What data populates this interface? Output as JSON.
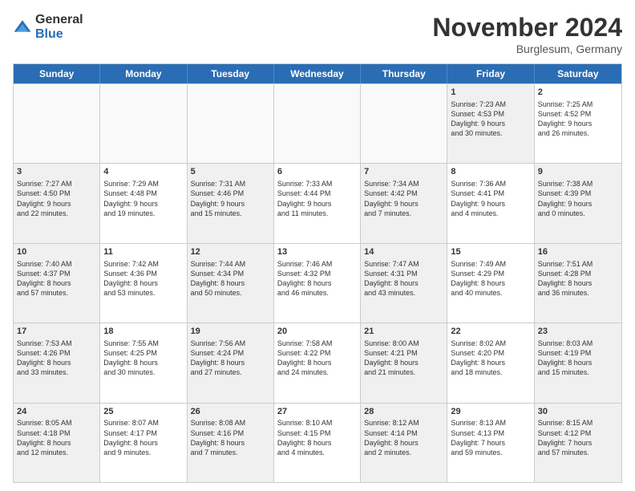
{
  "logo": {
    "general": "General",
    "blue": "Blue"
  },
  "title": "November 2024",
  "location": "Burglesum, Germany",
  "header_days": [
    "Sunday",
    "Monday",
    "Tuesday",
    "Wednesday",
    "Thursday",
    "Friday",
    "Saturday"
  ],
  "weeks": [
    [
      {
        "day": "",
        "info": "",
        "shaded": false,
        "empty": true
      },
      {
        "day": "",
        "info": "",
        "shaded": false,
        "empty": true
      },
      {
        "day": "",
        "info": "",
        "shaded": false,
        "empty": true
      },
      {
        "day": "",
        "info": "",
        "shaded": false,
        "empty": true
      },
      {
        "day": "",
        "info": "",
        "shaded": false,
        "empty": true
      },
      {
        "day": "1",
        "info": "Sunrise: 7:23 AM\nSunset: 4:53 PM\nDaylight: 9 hours\nand 30 minutes.",
        "shaded": true,
        "empty": false
      },
      {
        "day": "2",
        "info": "Sunrise: 7:25 AM\nSunset: 4:52 PM\nDaylight: 9 hours\nand 26 minutes.",
        "shaded": false,
        "empty": false
      }
    ],
    [
      {
        "day": "3",
        "info": "Sunrise: 7:27 AM\nSunset: 4:50 PM\nDaylight: 9 hours\nand 22 minutes.",
        "shaded": true,
        "empty": false
      },
      {
        "day": "4",
        "info": "Sunrise: 7:29 AM\nSunset: 4:48 PM\nDaylight: 9 hours\nand 19 minutes.",
        "shaded": false,
        "empty": false
      },
      {
        "day": "5",
        "info": "Sunrise: 7:31 AM\nSunset: 4:46 PM\nDaylight: 9 hours\nand 15 minutes.",
        "shaded": true,
        "empty": false
      },
      {
        "day": "6",
        "info": "Sunrise: 7:33 AM\nSunset: 4:44 PM\nDaylight: 9 hours\nand 11 minutes.",
        "shaded": false,
        "empty": false
      },
      {
        "day": "7",
        "info": "Sunrise: 7:34 AM\nSunset: 4:42 PM\nDaylight: 9 hours\nand 7 minutes.",
        "shaded": true,
        "empty": false
      },
      {
        "day": "8",
        "info": "Sunrise: 7:36 AM\nSunset: 4:41 PM\nDaylight: 9 hours\nand 4 minutes.",
        "shaded": false,
        "empty": false
      },
      {
        "day": "9",
        "info": "Sunrise: 7:38 AM\nSunset: 4:39 PM\nDaylight: 9 hours\nand 0 minutes.",
        "shaded": true,
        "empty": false
      }
    ],
    [
      {
        "day": "10",
        "info": "Sunrise: 7:40 AM\nSunset: 4:37 PM\nDaylight: 8 hours\nand 57 minutes.",
        "shaded": true,
        "empty": false
      },
      {
        "day": "11",
        "info": "Sunrise: 7:42 AM\nSunset: 4:36 PM\nDaylight: 8 hours\nand 53 minutes.",
        "shaded": false,
        "empty": false
      },
      {
        "day": "12",
        "info": "Sunrise: 7:44 AM\nSunset: 4:34 PM\nDaylight: 8 hours\nand 50 minutes.",
        "shaded": true,
        "empty": false
      },
      {
        "day": "13",
        "info": "Sunrise: 7:46 AM\nSunset: 4:32 PM\nDaylight: 8 hours\nand 46 minutes.",
        "shaded": false,
        "empty": false
      },
      {
        "day": "14",
        "info": "Sunrise: 7:47 AM\nSunset: 4:31 PM\nDaylight: 8 hours\nand 43 minutes.",
        "shaded": true,
        "empty": false
      },
      {
        "day": "15",
        "info": "Sunrise: 7:49 AM\nSunset: 4:29 PM\nDaylight: 8 hours\nand 40 minutes.",
        "shaded": false,
        "empty": false
      },
      {
        "day": "16",
        "info": "Sunrise: 7:51 AM\nSunset: 4:28 PM\nDaylight: 8 hours\nand 36 minutes.",
        "shaded": true,
        "empty": false
      }
    ],
    [
      {
        "day": "17",
        "info": "Sunrise: 7:53 AM\nSunset: 4:26 PM\nDaylight: 8 hours\nand 33 minutes.",
        "shaded": true,
        "empty": false
      },
      {
        "day": "18",
        "info": "Sunrise: 7:55 AM\nSunset: 4:25 PM\nDaylight: 8 hours\nand 30 minutes.",
        "shaded": false,
        "empty": false
      },
      {
        "day": "19",
        "info": "Sunrise: 7:56 AM\nSunset: 4:24 PM\nDaylight: 8 hours\nand 27 minutes.",
        "shaded": true,
        "empty": false
      },
      {
        "day": "20",
        "info": "Sunrise: 7:58 AM\nSunset: 4:22 PM\nDaylight: 8 hours\nand 24 minutes.",
        "shaded": false,
        "empty": false
      },
      {
        "day": "21",
        "info": "Sunrise: 8:00 AM\nSunset: 4:21 PM\nDaylight: 8 hours\nand 21 minutes.",
        "shaded": true,
        "empty": false
      },
      {
        "day": "22",
        "info": "Sunrise: 8:02 AM\nSunset: 4:20 PM\nDaylight: 8 hours\nand 18 minutes.",
        "shaded": false,
        "empty": false
      },
      {
        "day": "23",
        "info": "Sunrise: 8:03 AM\nSunset: 4:19 PM\nDaylight: 8 hours\nand 15 minutes.",
        "shaded": true,
        "empty": false
      }
    ],
    [
      {
        "day": "24",
        "info": "Sunrise: 8:05 AM\nSunset: 4:18 PM\nDaylight: 8 hours\nand 12 minutes.",
        "shaded": true,
        "empty": false
      },
      {
        "day": "25",
        "info": "Sunrise: 8:07 AM\nSunset: 4:17 PM\nDaylight: 8 hours\nand 9 minutes.",
        "shaded": false,
        "empty": false
      },
      {
        "day": "26",
        "info": "Sunrise: 8:08 AM\nSunset: 4:16 PM\nDaylight: 8 hours\nand 7 minutes.",
        "shaded": true,
        "empty": false
      },
      {
        "day": "27",
        "info": "Sunrise: 8:10 AM\nSunset: 4:15 PM\nDaylight: 8 hours\nand 4 minutes.",
        "shaded": false,
        "empty": false
      },
      {
        "day": "28",
        "info": "Sunrise: 8:12 AM\nSunset: 4:14 PM\nDaylight: 8 hours\nand 2 minutes.",
        "shaded": true,
        "empty": false
      },
      {
        "day": "29",
        "info": "Sunrise: 8:13 AM\nSunset: 4:13 PM\nDaylight: 7 hours\nand 59 minutes.",
        "shaded": false,
        "empty": false
      },
      {
        "day": "30",
        "info": "Sunrise: 8:15 AM\nSunset: 4:12 PM\nDaylight: 7 hours\nand 57 minutes.",
        "shaded": true,
        "empty": false
      }
    ]
  ]
}
